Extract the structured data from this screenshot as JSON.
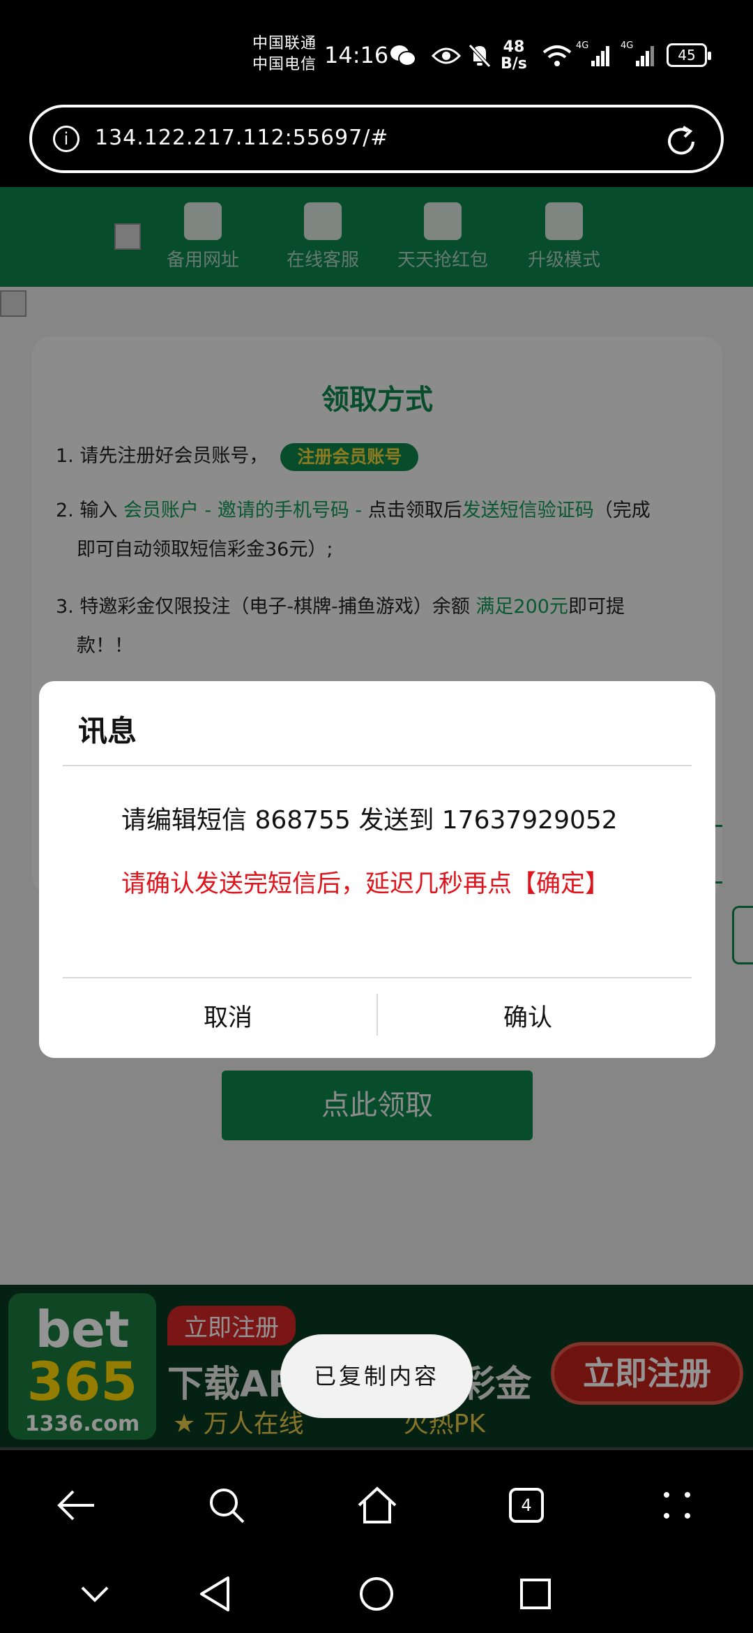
{
  "status_bar": {
    "carrier_1": "中国联通",
    "carrier_2": "中国电信",
    "time": "14:16",
    "net_speed_value": "48",
    "net_speed_unit": "B/s",
    "signal_1_label": "4G",
    "signal_2_label": "4G",
    "battery": "45"
  },
  "browser": {
    "url": "134.122.217.112:55697/#",
    "tabs_count": "4"
  },
  "page": {
    "nav_items": [
      {
        "label": "备用网址",
        "icon": "monitor-globe-icon"
      },
      {
        "label": "在线客服",
        "icon": "headset-icon"
      },
      {
        "label": "天天抢红包",
        "icon": "red-envelope-icon"
      },
      {
        "label": "升级模式",
        "icon": "upgrade-arrow-icon"
      }
    ],
    "card_title": "领取方式",
    "step1_text": "1. 请先注册好会员账号，",
    "step1_button": "注册会员账号",
    "step2_prefix": "2. 输入 ",
    "step2_green1": "会员账户 - 邀请的手机号码 - ",
    "step2_mid": "点击领取后",
    "step2_green2": "发送短信验证码",
    "step2_suffix": "（完成",
    "step2_line2": "即可自动领取短信彩金36元）;",
    "step3_prefix": "3. 特邀彩金仅限投注（电子-棋牌-捕鱼游戏）余额 ",
    "step3_green": "满足200元",
    "step3_suffix": "即可提",
    "step3_line2": "款！！",
    "claim_button": "点此领取"
  },
  "ad": {
    "logo_line1": "bet",
    "logo_line2": "365",
    "logo_domain": "1336.com",
    "tag": "立即注册",
    "headline_left": "下载AP",
    "headline_right": "彩金",
    "sub_left": "万人在线",
    "sub_right": "火热PK",
    "cta": "立即注册"
  },
  "dialog": {
    "title": "讯息",
    "message": "请编辑短信 868755 发送到 17637929052",
    "warning": "请确认发送完短信后，延迟几秒再点【确定】",
    "cancel": "取消",
    "confirm": "确认"
  },
  "toast": "已复制内容",
  "colors": {
    "brand_green": "#0d8a4f",
    "warning_red": "#e0141c",
    "highlight_yellow": "#ffe040"
  }
}
